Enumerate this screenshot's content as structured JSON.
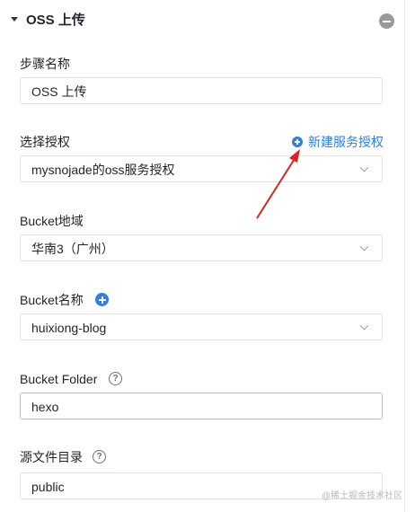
{
  "step": {
    "title": "OSS 上传"
  },
  "fields": {
    "step_name": {
      "label": "步骤名称",
      "value": "OSS 上传"
    },
    "authorization": {
      "label": "选择授权",
      "value": "mysnojade的oss服务授权",
      "new_link": "新建服务授权"
    },
    "bucket_region": {
      "label": "Bucket地域",
      "value": "华南3（广州）"
    },
    "bucket_name": {
      "label": "Bucket名称",
      "value": "huixiong-blog"
    },
    "bucket_folder": {
      "label": "Bucket Folder",
      "value": "hexo"
    },
    "source_dir": {
      "label": "源文件目录",
      "value": "public"
    }
  },
  "watermark": "@稀土掘金技术社区",
  "colors": {
    "accent": "#2f7ee6",
    "arrow": "#e02020"
  }
}
